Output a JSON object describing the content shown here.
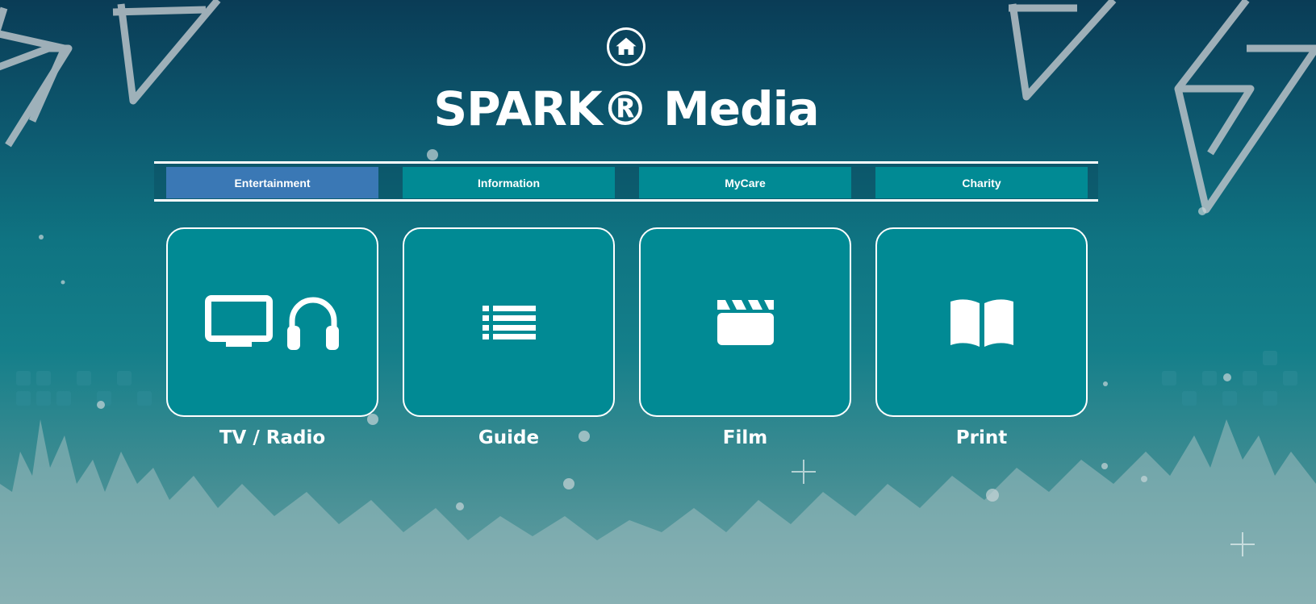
{
  "header": {
    "home_icon": "home-icon",
    "title": "SPARK® Media"
  },
  "nav": {
    "tabs": [
      {
        "label": "Entertainment",
        "active": true
      },
      {
        "label": "Information",
        "active": false
      },
      {
        "label": "MyCare",
        "active": false
      },
      {
        "label": "Charity",
        "active": false
      }
    ]
  },
  "tiles": [
    {
      "label": "TV / Radio",
      "icons": [
        "tv-icon",
        "headphones-icon"
      ]
    },
    {
      "label": "Guide",
      "icons": [
        "list-icon"
      ]
    },
    {
      "label": "Film",
      "icons": [
        "clapperboard-icon"
      ]
    },
    {
      "label": "Print",
      "icons": [
        "open-book-icon"
      ]
    }
  ],
  "colors": {
    "tab_active": "#3a78b5",
    "tab_inactive": "#018a94",
    "tile": "#018a94",
    "text": "#ffffff"
  }
}
